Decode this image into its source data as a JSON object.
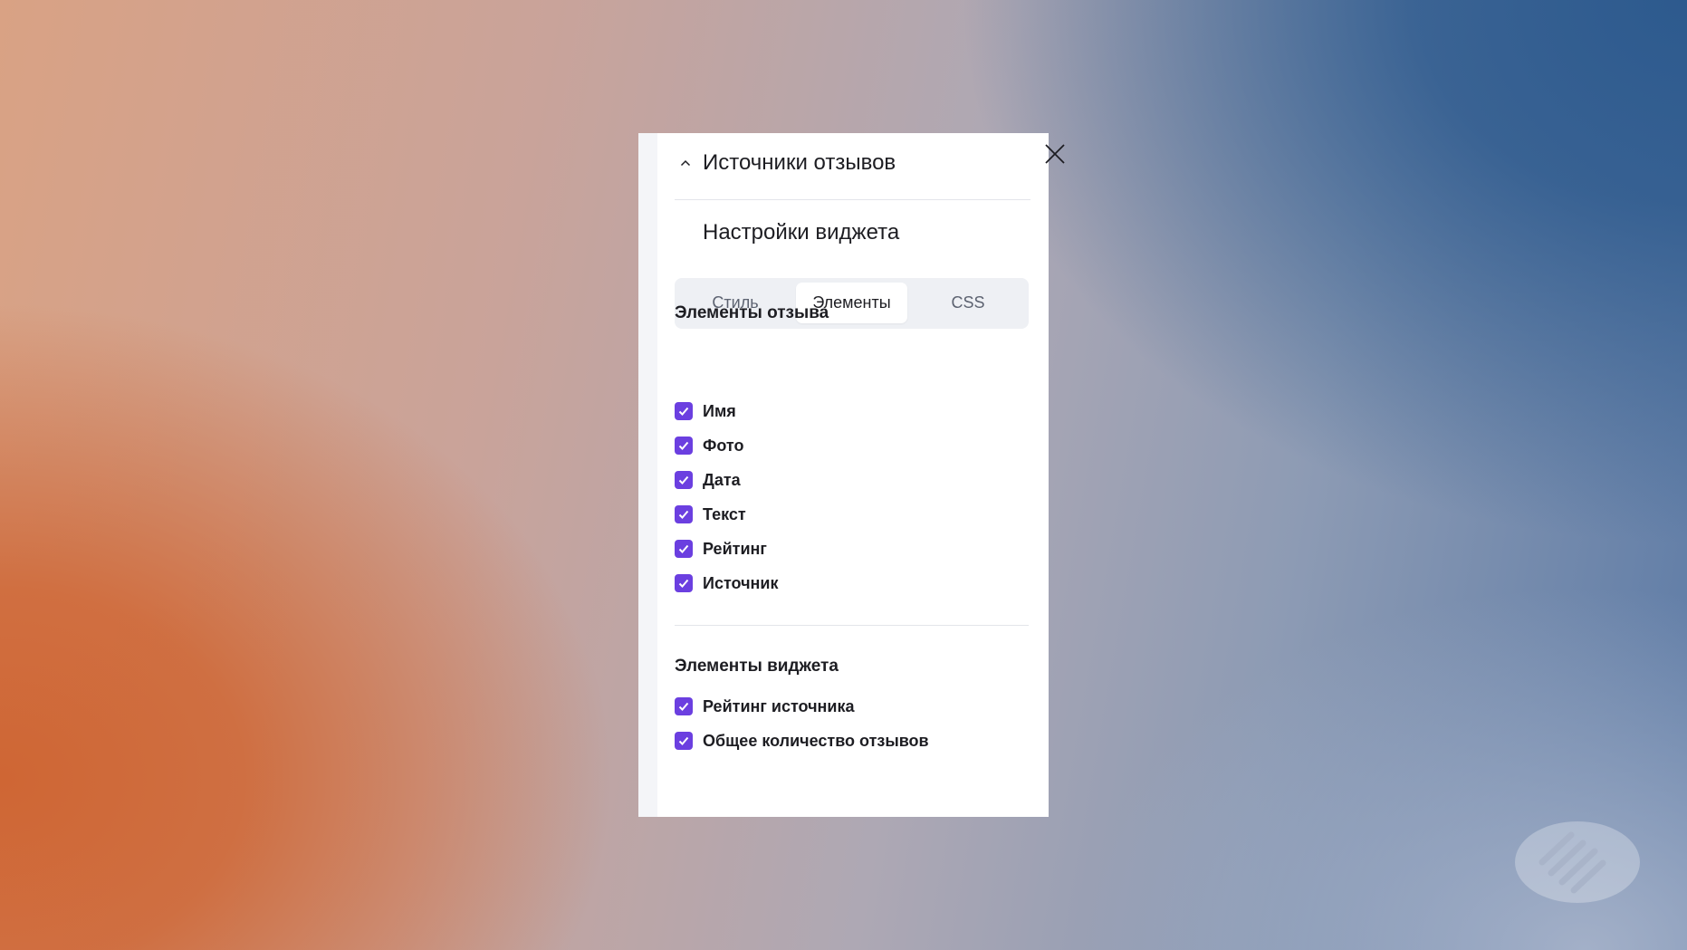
{
  "panel": {
    "header_title": "Источники отзывов",
    "section_title": "Настройки виджета"
  },
  "tabs": [
    {
      "label": "Стиль",
      "active": false
    },
    {
      "label": "Элементы",
      "active": true
    },
    {
      "label": "CSS",
      "active": false
    }
  ],
  "review_elements": {
    "title": "Элементы отзыва",
    "items": [
      {
        "label": "Имя",
        "checked": true
      },
      {
        "label": "Фото",
        "checked": true
      },
      {
        "label": "Дата",
        "checked": true
      },
      {
        "label": "Текст",
        "checked": true
      },
      {
        "label": "Рейтинг",
        "checked": true
      },
      {
        "label": "Источник",
        "checked": true
      }
    ]
  },
  "widget_elements": {
    "title": "Элементы виджета",
    "items": [
      {
        "label": "Рейтинг источника",
        "checked": true
      },
      {
        "label": "Общее количество отзывов",
        "checked": true
      }
    ]
  },
  "icons": {
    "collapse": "chevron-up-icon",
    "close": "close-icon",
    "check": "check-icon",
    "watermark": "logo-icon"
  },
  "colors": {
    "checkbox_accent": "#6b3fe0",
    "tab_bar": "#eef0f4"
  }
}
